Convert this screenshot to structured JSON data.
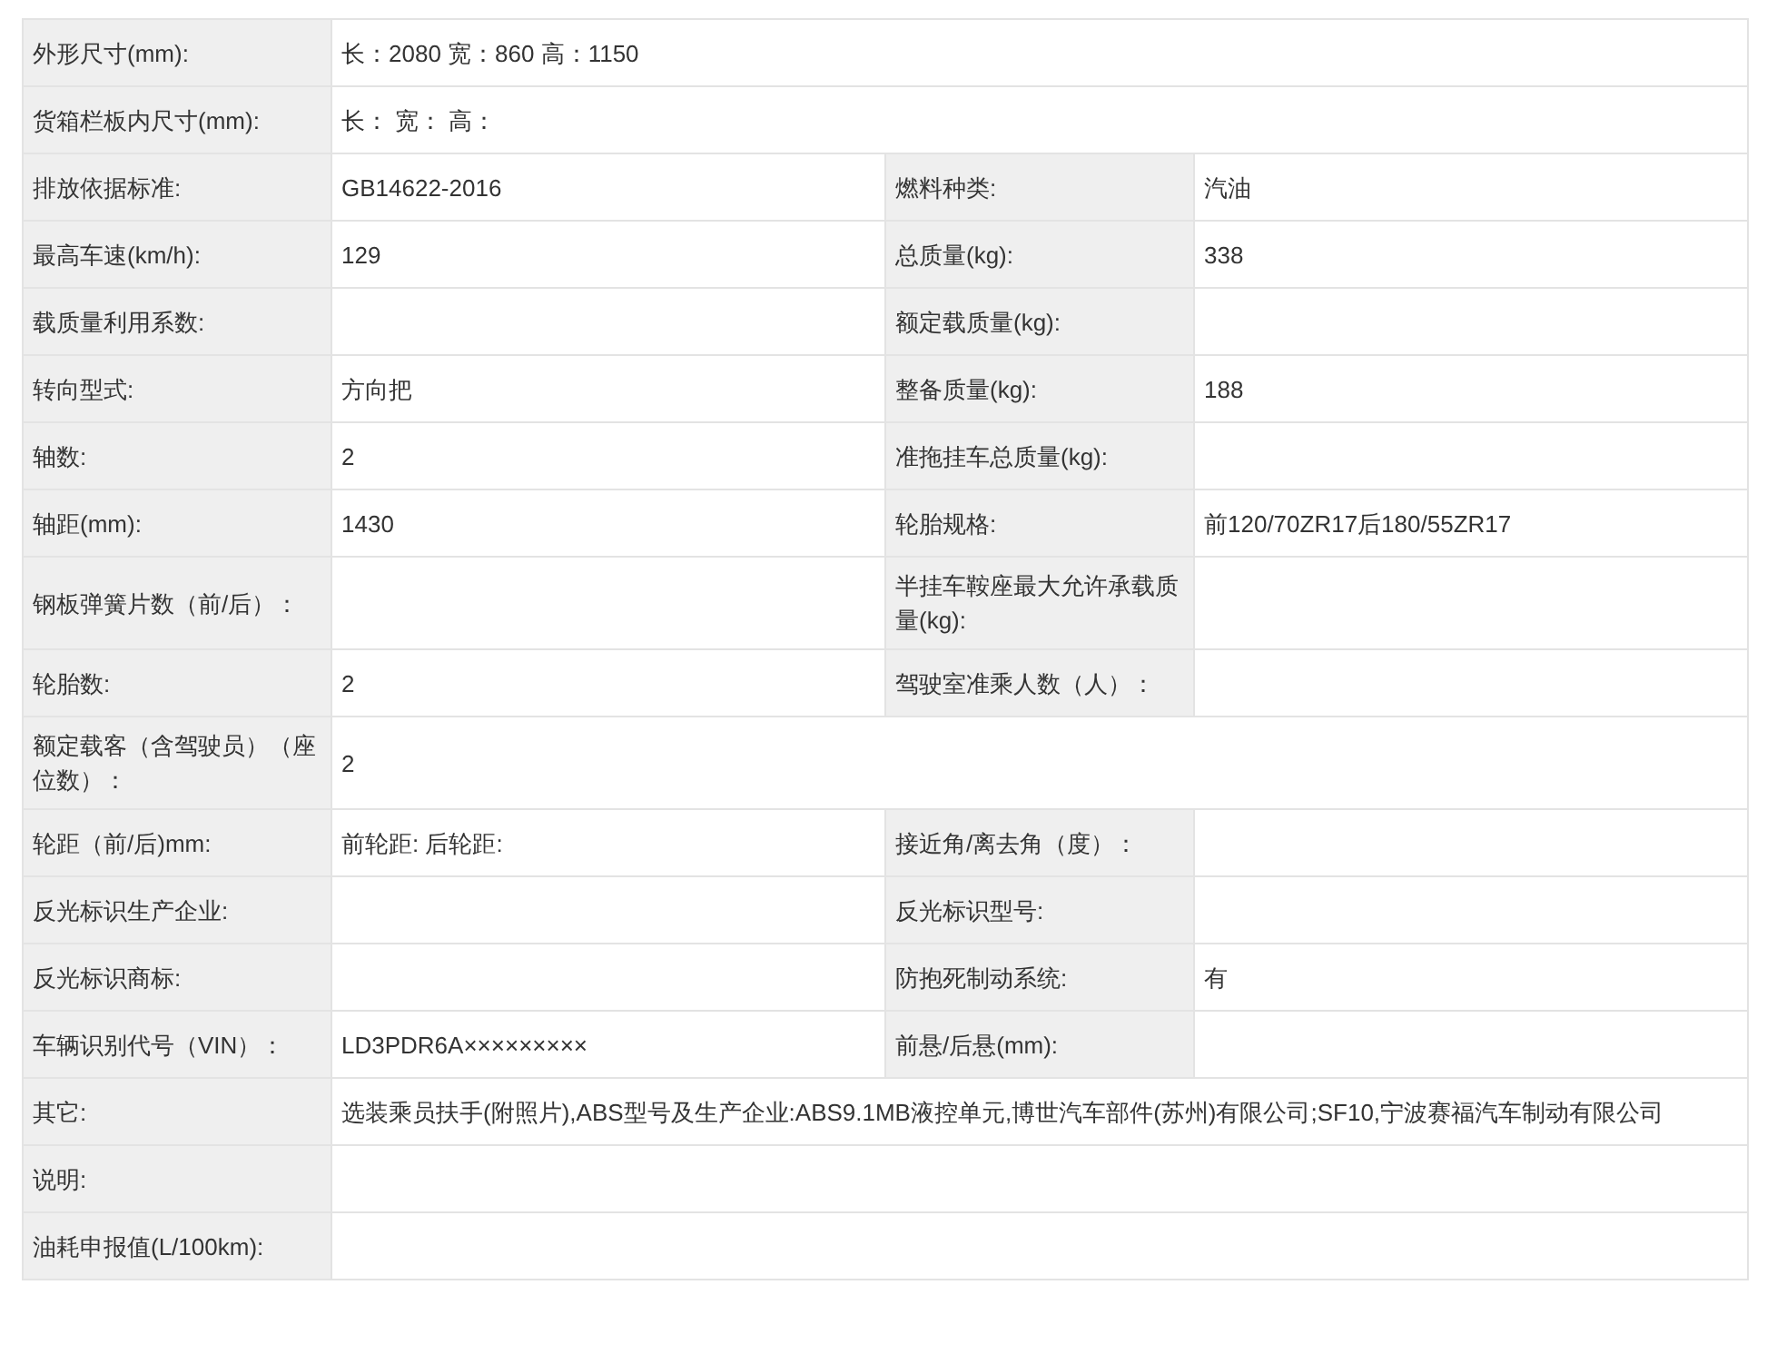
{
  "rows": [
    {
      "fields": [
        {
          "label": "外形尺寸(mm):",
          "value": "长：2080 宽：860 高：1150"
        }
      ]
    },
    {
      "fields": [
        {
          "label": "货箱栏板内尺寸(mm):",
          "value": "长： 宽： 高："
        }
      ]
    },
    {
      "fields": [
        {
          "label": "排放依据标准:",
          "value": "GB14622-2016"
        },
        {
          "label": "燃料种类:",
          "value": "汽油"
        }
      ]
    },
    {
      "fields": [
        {
          "label": "最高车速(km/h):",
          "value": "129"
        },
        {
          "label": "总质量(kg):",
          "value": "338"
        }
      ]
    },
    {
      "fields": [
        {
          "label": "载质量利用系数:"
        },
        {
          "label": "额定载质量(kg):"
        }
      ]
    },
    {
      "fields": [
        {
          "label": "转向型式:",
          "value": "方向把"
        },
        {
          "label": "整备质量(kg):",
          "value": "188"
        }
      ]
    },
    {
      "fields": [
        {
          "label": "轴数:",
          "value": "2"
        },
        {
          "label": "准拖挂车总质量(kg):"
        }
      ]
    },
    {
      "fields": [
        {
          "label": "轴距(mm):",
          "value": "1430"
        },
        {
          "label": "轮胎规格:",
          "value": "前120/70ZR17后180/55ZR17"
        }
      ]
    },
    {
      "fields": [
        {
          "label": "钢板弹簧片数（前/后）："
        },
        {
          "label": "半挂车鞍座最大允许承载质量(kg):"
        }
      ]
    },
    {
      "fields": [
        {
          "label": "轮胎数:",
          "value": "2"
        },
        {
          "label": "驾驶室准乘人数（人）："
        }
      ]
    },
    {
      "fields": [
        {
          "label": "额定载客（含驾驶员）（座位数）：",
          "value": "2"
        }
      ]
    },
    {
      "fields": [
        {
          "label": "轮距（前/后)mm:",
          "value": "前轮距: 后轮距:"
        },
        {
          "label": "接近角/离去角（度）："
        }
      ]
    },
    {
      "fields": [
        {
          "label": "反光标识生产企业:"
        },
        {
          "label": "反光标识型号:"
        }
      ]
    },
    {
      "fields": [
        {
          "label": "反光标识商标:"
        },
        {
          "label": "防抱死制动系统:",
          "value": "有"
        }
      ]
    },
    {
      "fields": [
        {
          "label": "车辆识别代号（VIN）：",
          "value": "LD3PDR6A×××××××××"
        },
        {
          "label": "前悬/后悬(mm):"
        }
      ]
    },
    {
      "fields": [
        {
          "label": "其它:",
          "value": "选装乘员扶手(附照片),ABS型号及生产企业:ABS9.1MB液控单元,博世汽车部件(苏州)有限公司;SF10,宁波赛福汽车制动有限公司"
        }
      ]
    },
    {
      "fields": [
        {
          "label": "说明:"
        }
      ]
    },
    {
      "fields": [
        {
          "label": "油耗申报值(L/100km):"
        }
      ]
    }
  ]
}
